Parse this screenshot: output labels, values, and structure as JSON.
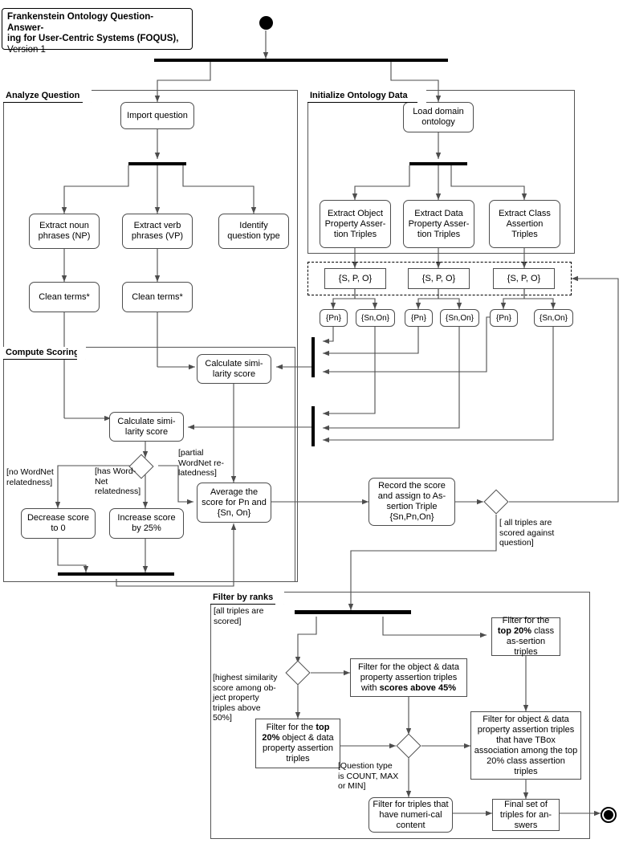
{
  "title": {
    "line1": "Frankenstein Ontology Question-Answer-",
    "line2": "ing for User-Centric Systems (FOQUS),",
    "line3": "Version 1"
  },
  "partitions": {
    "analyze": "Analyze Question",
    "initialize": "Initialize Ontology Data",
    "scoring": "Compute Scoring",
    "filter": "Filter by ranks"
  },
  "analyze_question": {
    "import_question": "Import question",
    "extract_noun": "Extract noun phrases (NP)",
    "extract_verb": "Extract verb phrases (VP)",
    "identify_type": "Identify question type",
    "clean_terms_np": "Clean terms*",
    "clean_terms_vp": "Clean terms*"
  },
  "initialize_ontology": {
    "load_domain": "Load domain ontology",
    "extract_object_property": "Extract Object Property Asser-tion Triples",
    "extract_data_property": "Extract Data Property Asser-tion Triples",
    "extract_class": "Extract Class Assertion Triples"
  },
  "triples": {
    "spo_object": "{S, P, O}",
    "spo_data": "{S, P, O}",
    "spo_class": "{S, P, O}",
    "tokens": [
      {
        "label": "{Pn}"
      },
      {
        "label": "{Sn,On}"
      },
      {
        "label": "{Pn}"
      },
      {
        "label": "{Sn,On}"
      },
      {
        "label": "{Pn}"
      },
      {
        "label": "{Sn,On}"
      }
    ]
  },
  "compute_scoring": {
    "calc_similarity_top": "Calculate simi-larity score",
    "calc_similarity_bottom": "Calculate simi-larity score",
    "decrease_score": "Decrease score to 0",
    "increase_score": "Increase score by 25%",
    "average_score": "Average the score for Pn and {Sn, On}",
    "record_score": "Record the score and assign to As-sertion Triple {Sn,Pn,On}",
    "guards": {
      "no_wordnet": "[no WordNet relatedness]",
      "has_wordnet": "[has Word-Net relatedness]",
      "partial_wordnet": "[partial WordNet re-latedness]",
      "all_triples_scored": "[ all triples are scored against question]"
    }
  },
  "filter_by_ranks": {
    "filter_top20_class": "Filter for the top 20% class as-sertion triples",
    "filter_obj_data_scores": "Filter for the object & data property assertion triples with scores above 45%",
    "filter_top20_objdata": "Filter for the top 20% object & data property assertion triples",
    "filter_tbox": "Filter for object & data property assertion triples that have TBox association among the top 20% class assertion triples",
    "filter_numerical": "Filter for triples that have numeri-cal content",
    "final_set": "Final set of triples for an-swers",
    "guards": {
      "all_triples_scored": "[all triples are scored]",
      "highest_similarity": "[highest similarity score among ob-ject property triples above 50%]",
      "question_type": "[Question type is COUNT, MAX or MIN]"
    }
  },
  "colors": {
    "stroke": "#4d4d4d",
    "bar": "#000000",
    "partition_border": "#555555",
    "background": "#ffffff"
  }
}
